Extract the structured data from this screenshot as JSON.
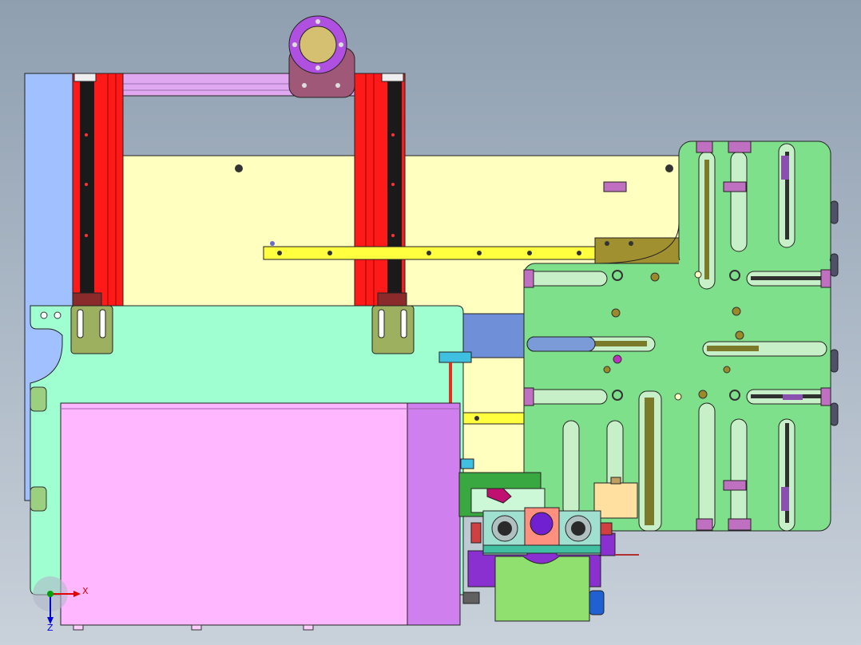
{
  "viewport": {
    "background_top": "#8f9fb0",
    "background_bottom": "#c9d1da"
  },
  "colors": {
    "rail_red": "#ff1a1a",
    "rail_dark": "#1a1a1a",
    "back_plate": "#ffffc0",
    "side_panel_blue": "#a0c0ff",
    "mint_plate": "#a0ffd0",
    "pink_box": "#ffb8ff",
    "pink_box_side": "#d080ee",
    "green_plate": "#7ee08a",
    "yellow_strip": "#ffff40",
    "purple_motor": "#b050e0",
    "tan_block": "#ffe0a0"
  },
  "triad": {
    "x_label": "X",
    "z_label": "Z",
    "x_color": "#e00000",
    "y_color": "#00a000",
    "z_color": "#0000e0"
  }
}
